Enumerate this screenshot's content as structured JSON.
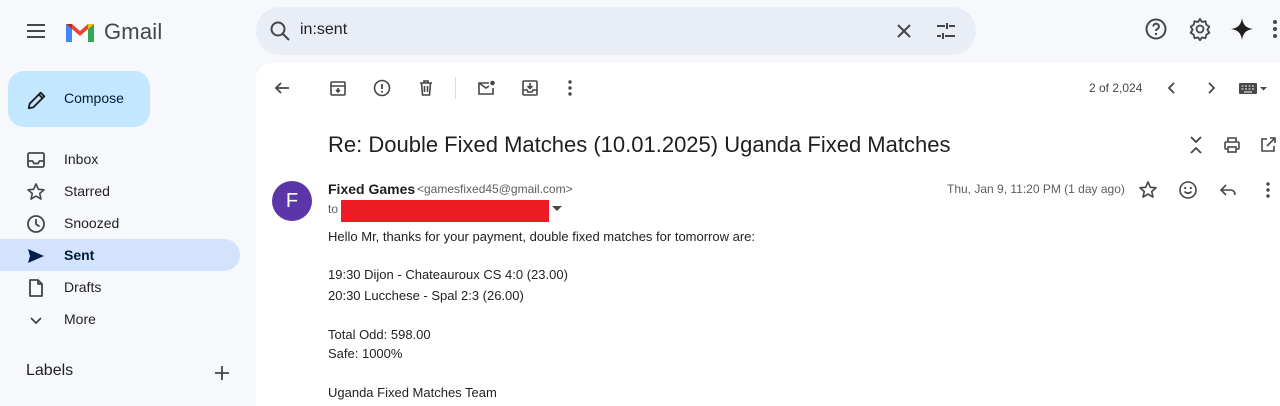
{
  "app": {
    "name": "Gmail"
  },
  "search": {
    "query": "in:sent"
  },
  "sidebar": {
    "compose_label": "Compose",
    "items": [
      {
        "label": "Inbox"
      },
      {
        "label": "Starred"
      },
      {
        "label": "Snoozed"
      },
      {
        "label": "Sent",
        "active": true
      },
      {
        "label": "Drafts"
      },
      {
        "label": "More"
      }
    ],
    "labels_title": "Labels"
  },
  "toolbar": {
    "pager": "2 of 2,024"
  },
  "email": {
    "subject": "Re: Double Fixed Matches (10.01.2025) Uganda Fixed Matches",
    "sender": {
      "avatar_letter": "F",
      "name": "Fixed Games",
      "email": "<gamesfixed45@gmail.com>"
    },
    "to_label": "to",
    "date": "Thu, Jan 9, 11:20 PM (1 day ago)",
    "body": {
      "greeting": "Hello Mr, thanks for your payment, double fixed matches for tomorrow are:",
      "match1": "19:30 Dijon - Chateauroux CS 4:0 (23.00)",
      "match2": "20:30 Lucchese - Spal 2:3 (26.00)",
      "total_odd": "Total Odd: 598.00",
      "safe": "Safe: 1000%",
      "signature": "Uganda Fixed Matches Team"
    }
  },
  "colors": {
    "avatar": "#5c35a8",
    "compose_bg": "#c2e7ff",
    "active_nav": "#d3e3fd",
    "redaction": "#ed1c24"
  }
}
